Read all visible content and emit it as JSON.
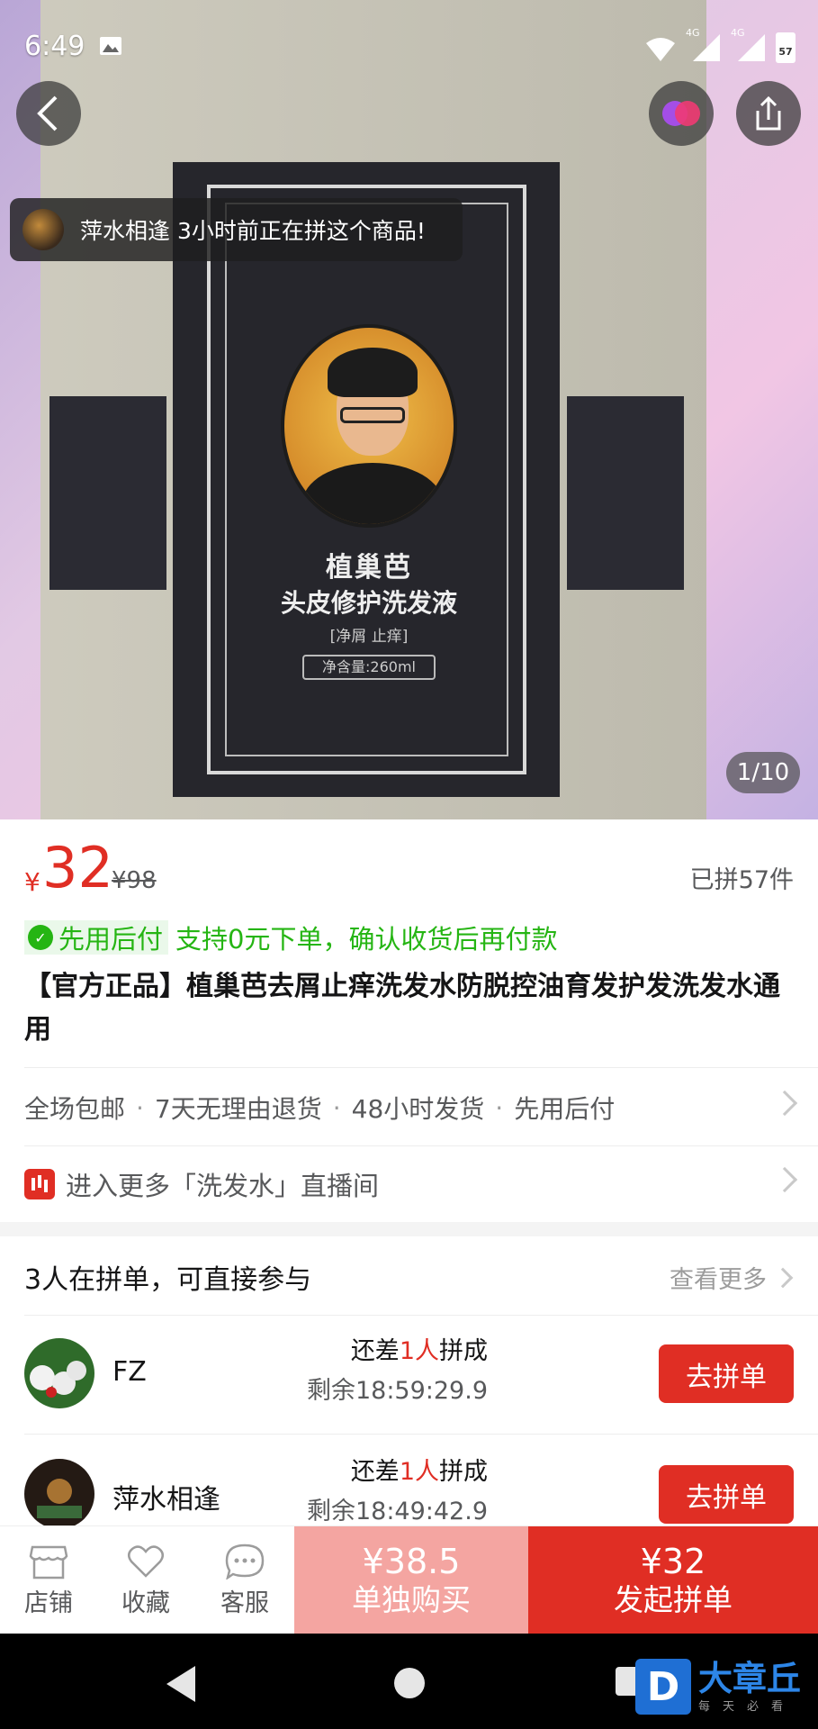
{
  "status_bar": {
    "time": "6:49",
    "network1": "4G",
    "network2": "4G",
    "battery": "57"
  },
  "gallery": {
    "counter": "1/10",
    "product_label_line1": "植巢芭",
    "product_label_line2": "头皮修护洗发液",
    "product_label_line3": "[净屑 止痒]",
    "product_label_line4": "净含量:260ml",
    "group_toast": "萍水相逢 3小时前正在拼这个商品!"
  },
  "price": {
    "currency": "¥",
    "value": "32",
    "original": "¥98",
    "sold": "已拼57件"
  },
  "pay_later": {
    "tag": "先用后付",
    "desc": "支持0元下单，确认收货后再付款"
  },
  "title": "【官方正品】植巢芭去屑止痒洗发水防脱控油育发护发洗发水通用",
  "services": [
    "全场包邮",
    "7天无理由退货",
    "48小时发货",
    "先用后付"
  ],
  "live": "进入更多「洗发水」直播间",
  "groups": {
    "heading": "3人在拼单，可直接参与",
    "more": "查看更多",
    "items": [
      {
        "name": "FZ",
        "need_prefix": "还差",
        "need_count": "1人",
        "need_suffix": "拼成",
        "remaining": "剩余18:59:29.9",
        "button": "去拼单"
      },
      {
        "name": "萍水相逢",
        "need_prefix": "还差",
        "need_count": "1人",
        "need_suffix": "拼成",
        "remaining": "剩余18:49:42.9",
        "button": "去拼单"
      }
    ]
  },
  "bottom_bar": {
    "store": "店铺",
    "favorite": "收藏",
    "service": "客服",
    "alone_price": "¥38.5",
    "alone_label": "单独购买",
    "group_price": "¥32",
    "group_label": "发起拼单"
  },
  "watermark": {
    "letter": "D",
    "brand": "大章丘",
    "tagline": "每天必看"
  },
  "colors": {
    "accent": "#e02e24",
    "green": "#25b513",
    "light_red": "#f4a5a1"
  }
}
